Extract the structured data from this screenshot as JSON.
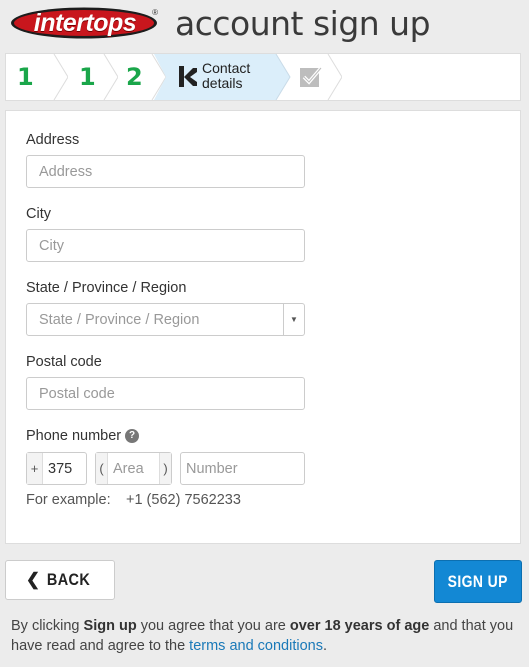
{
  "header": {
    "logo_text": "intertops",
    "logo_reg": "®",
    "title": "account sign up"
  },
  "steps": {
    "items": [
      {
        "label": "1",
        "state": "done"
      },
      {
        "label": "1",
        "state": "done"
      },
      {
        "label": "2",
        "state": "done"
      },
      {
        "label": "Contact details",
        "state": "active"
      },
      {
        "label": "",
        "state": "pending"
      }
    ],
    "active_line1": "Contact",
    "active_line2": "details"
  },
  "form": {
    "address": {
      "label": "Address",
      "placeholder": "Address",
      "value": ""
    },
    "city": {
      "label": "City",
      "placeholder": "City",
      "value": ""
    },
    "region": {
      "label": "State / Province / Region",
      "placeholder": "State / Province / Region"
    },
    "postal": {
      "label": "Postal code",
      "placeholder": "Postal code",
      "value": ""
    },
    "phone": {
      "label": "Phone number",
      "help_icon": "question-circle",
      "plus": "+",
      "country_code": "375",
      "paren_open": "(",
      "area_placeholder": "Area",
      "paren_close": ")",
      "number_placeholder": "Number",
      "example_label": "For example:",
      "example_value": "+1 (562) 7562233"
    }
  },
  "actions": {
    "back_label": "BACK",
    "signup_label": "SIGN UP"
  },
  "terms": {
    "t1": "By clicking ",
    "b1": "Sign up",
    "t2": " you agree that you are ",
    "b2": "over 18 years of age",
    "t3": " and that you have read and agree to the ",
    "link": "terms and conditions",
    "t4": "."
  },
  "colors": {
    "accent_green": "#1aa64a",
    "active_step_bg": "#dbeefa",
    "primary_blue": "#1388d4",
    "logo_red": "#c8161d"
  }
}
